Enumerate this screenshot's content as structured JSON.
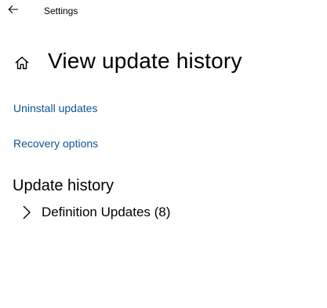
{
  "titlebar": {
    "title": "Settings",
    "back_icon": "back-arrow-icon"
  },
  "header": {
    "icon": "home-icon",
    "title": "View update history"
  },
  "links": {
    "uninstall_updates": "Uninstall updates",
    "recovery_options": "Recovery options"
  },
  "history": {
    "heading": "Update history",
    "categories": [
      {
        "label": "Definition Updates (8)",
        "icon": "chevron-right-icon",
        "expanded": false
      }
    ]
  },
  "colors": {
    "link": "#0b5394",
    "text": "#000000",
    "background": "#ffffff"
  }
}
